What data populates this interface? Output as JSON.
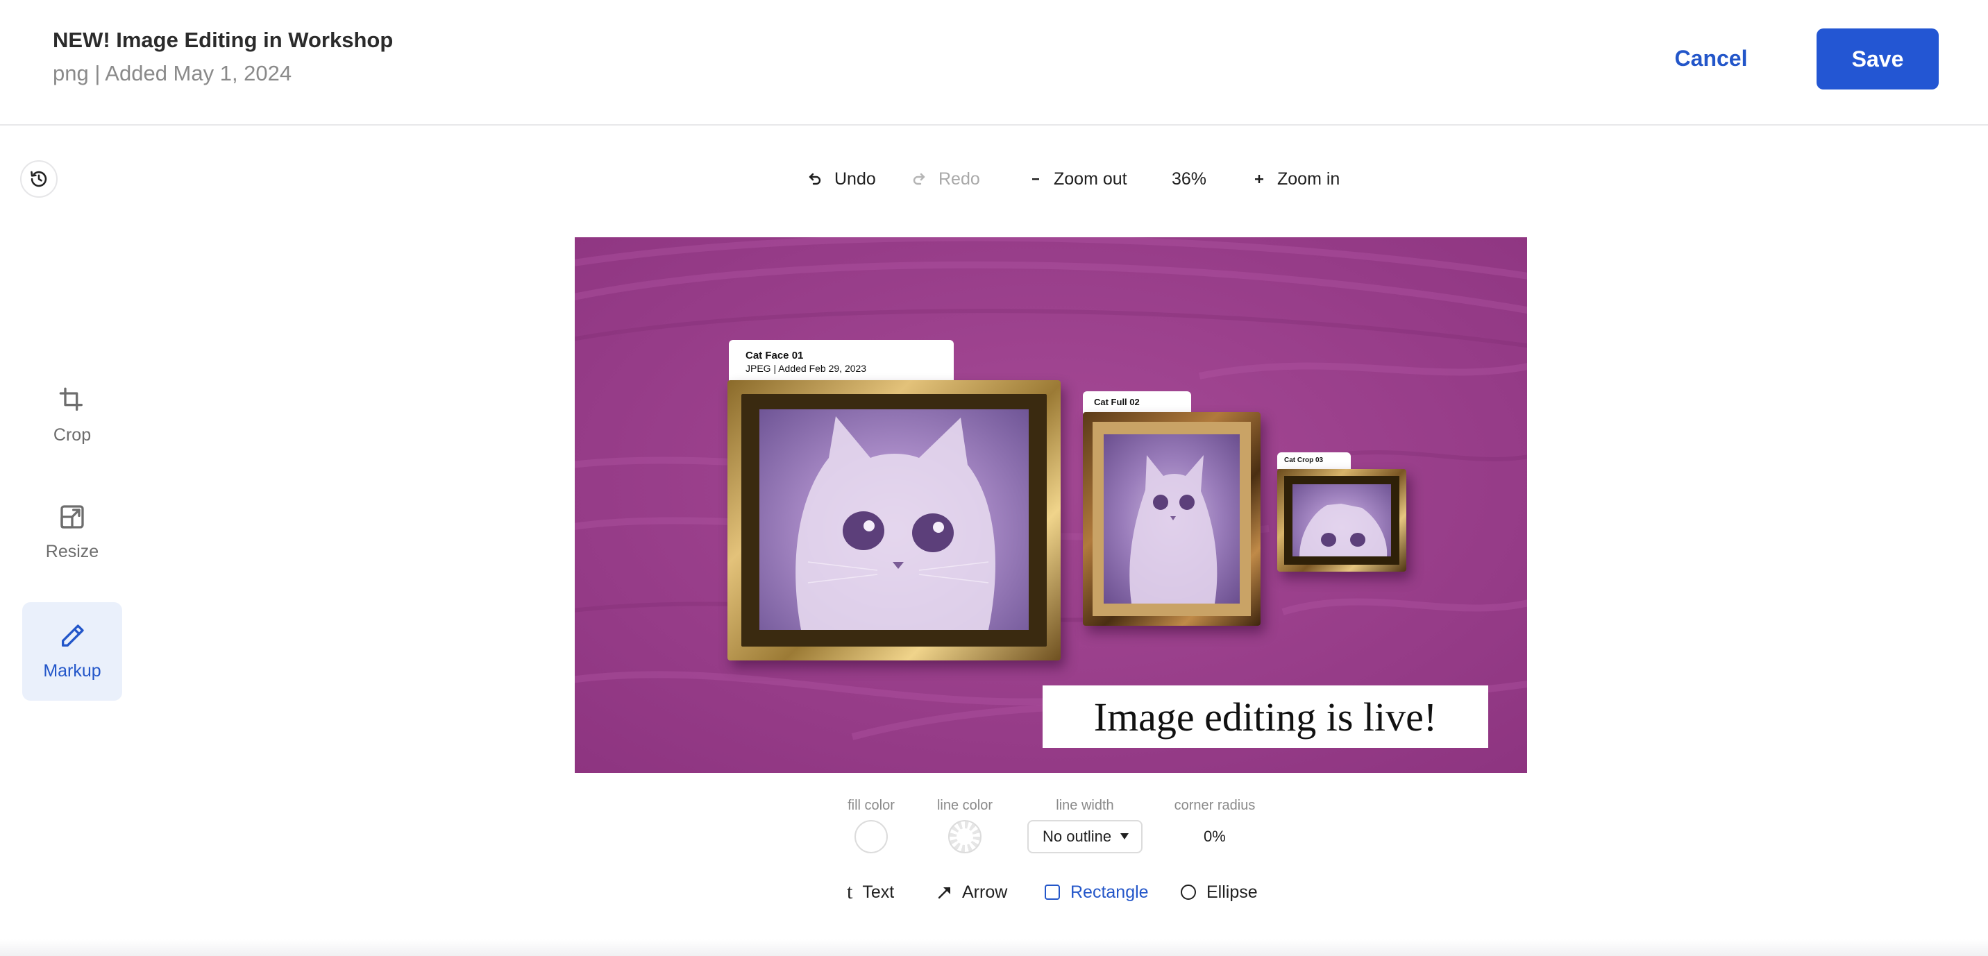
{
  "header": {
    "title": "NEW! Image Editing in Workshop",
    "subtitle": "png | Added May 1, 2024",
    "cancel_label": "Cancel",
    "save_label": "Save"
  },
  "toolbar": {
    "undo_label": "Undo",
    "redo_label": "Redo",
    "zoom_out_label": "Zoom out",
    "zoom_level": "36%",
    "zoom_in_label": "Zoom in"
  },
  "side_tools": [
    {
      "label": "Crop",
      "icon": "crop-icon",
      "active": false
    },
    {
      "label": "Resize",
      "icon": "resize-icon",
      "active": false
    },
    {
      "label": "Markup",
      "icon": "pencil-icon",
      "active": true
    }
  ],
  "canvas": {
    "frame1_title": "Cat Face 01",
    "frame1_meta": "JPEG | Added Feb 29, 2023",
    "frame2_title": "Cat Full 02",
    "frame3_title": "Cat Crop 03",
    "caption": "Image editing is live!",
    "background_color": "#9b3f8b"
  },
  "markup_props": {
    "fill_color_label": "fill color",
    "line_color_label": "line color",
    "line_width_label": "line width",
    "line_width_value": "No outline",
    "corner_radius_label": "corner radius",
    "corner_radius_value": "0%"
  },
  "shape_tools": [
    {
      "label": "Text",
      "icon": "text-icon",
      "active": false
    },
    {
      "label": "Arrow",
      "icon": "arrow-icon",
      "active": false
    },
    {
      "label": "Rectangle",
      "icon": "rectangle-icon",
      "active": true
    },
    {
      "label": "Ellipse",
      "icon": "ellipse-icon",
      "active": false
    }
  ],
  "colors": {
    "accent": "#2356d3",
    "active_bg": "#eaf0fb"
  }
}
